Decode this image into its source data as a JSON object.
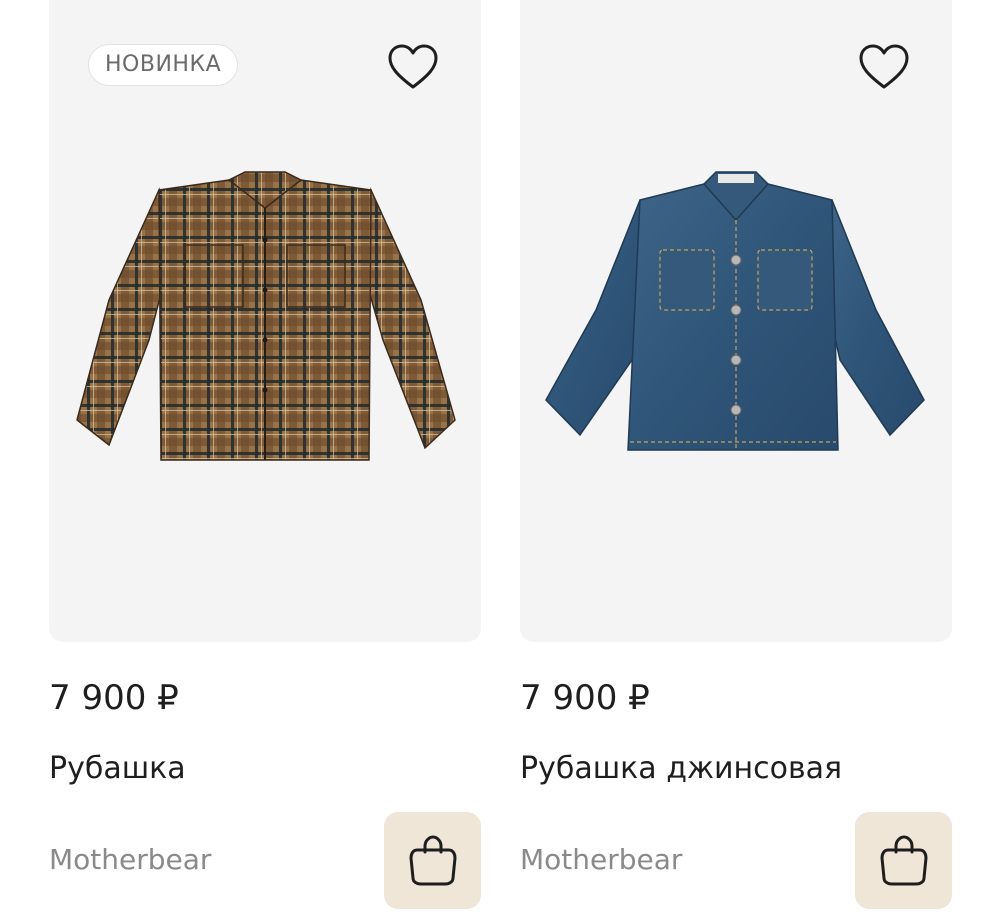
{
  "products": [
    {
      "badge": "НОВИНКА",
      "price": "7 900 ₽",
      "title": "Рубашка",
      "brand": "Motherbear"
    },
    {
      "price": "7 900 ₽",
      "title": "Рубашка джинсовая",
      "brand": "Motherbear"
    }
  ],
  "colors": {
    "card_background": "#f4f4f4",
    "cart_button": "#efe6d8",
    "text_primary": "#1e1e1e",
    "text_secondary": "#8a8a8a"
  },
  "icons": [
    "heart-icon",
    "shopping-bag-icon"
  ]
}
